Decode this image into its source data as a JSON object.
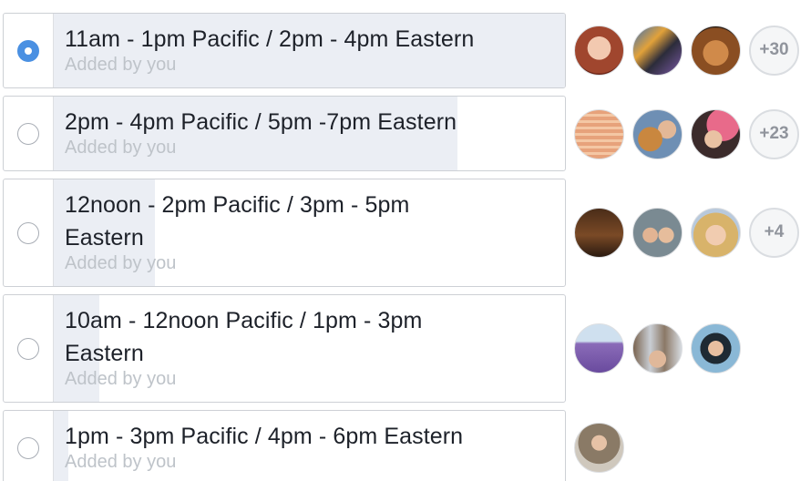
{
  "poll": {
    "options": [
      {
        "label": "11am - 1pm Pacific / 2pm - 4pm Eastern",
        "added_by": "Added by you",
        "selected": true,
        "vote_fraction": 1.0,
        "more_count": "+30"
      },
      {
        "label": "2pm - 4pm Pacific / 5pm -7pm Eastern",
        "added_by": "Added by you",
        "selected": false,
        "vote_fraction": 0.79,
        "more_count": "+23"
      },
      {
        "label": "12noon - 2pm Pacific / 3pm - 5pm Eastern",
        "added_by": "Added by you",
        "selected": false,
        "vote_fraction": 0.2,
        "more_count": "+4"
      },
      {
        "label": "10am - 12noon Pacific / 1pm - 3pm Eastern",
        "added_by": "Added by you",
        "selected": false,
        "vote_fraction": 0.09,
        "more_count": ""
      },
      {
        "label": "1pm - 3pm Pacific / 4pm - 6pm Eastern",
        "added_by": "Added by you",
        "selected": false,
        "vote_fraction": 0.03,
        "more_count": ""
      }
    ]
  },
  "colors": {
    "radio_selected": "#4a90e2",
    "vote_fill": "#ebeef4",
    "muted_text": "#bec3c9"
  }
}
